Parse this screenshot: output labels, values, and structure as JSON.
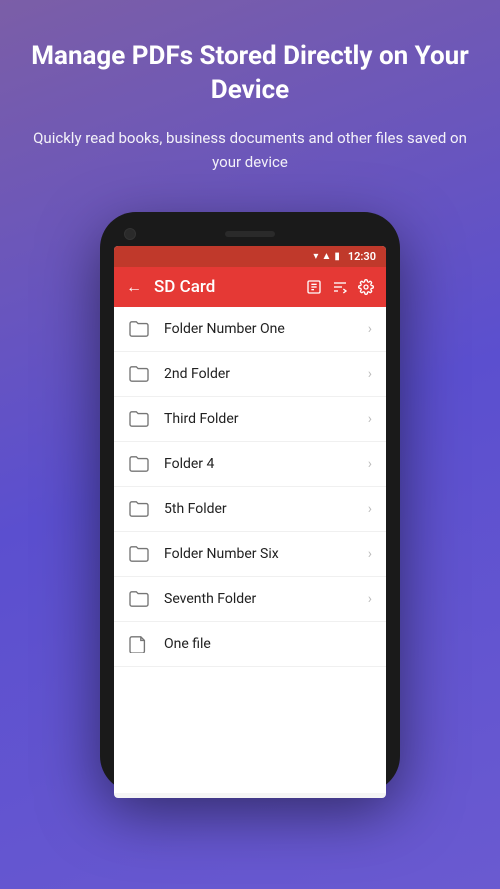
{
  "hero": {
    "title": "Manage PDFs Stored Directly on Your Device",
    "subtitle": "Quickly read books, business documents and other files saved on your device"
  },
  "status_bar": {
    "time": "12:30"
  },
  "app_bar": {
    "title": "SD Card",
    "back_label": "←",
    "icon_file": "❐",
    "icon_folder": "⬆",
    "icon_settings": "⚙"
  },
  "file_list": [
    {
      "name": "Folder Number One",
      "type": "folder"
    },
    {
      "name": "2nd Folder",
      "type": "folder"
    },
    {
      "name": "Third Folder",
      "type": "folder"
    },
    {
      "name": "Folder 4",
      "type": "folder"
    },
    {
      "name": "5th Folder",
      "type": "folder"
    },
    {
      "name": "Folder Number Six",
      "type": "folder"
    },
    {
      "name": "Seventh Folder",
      "type": "folder"
    },
    {
      "name": "One file",
      "type": "file"
    }
  ]
}
